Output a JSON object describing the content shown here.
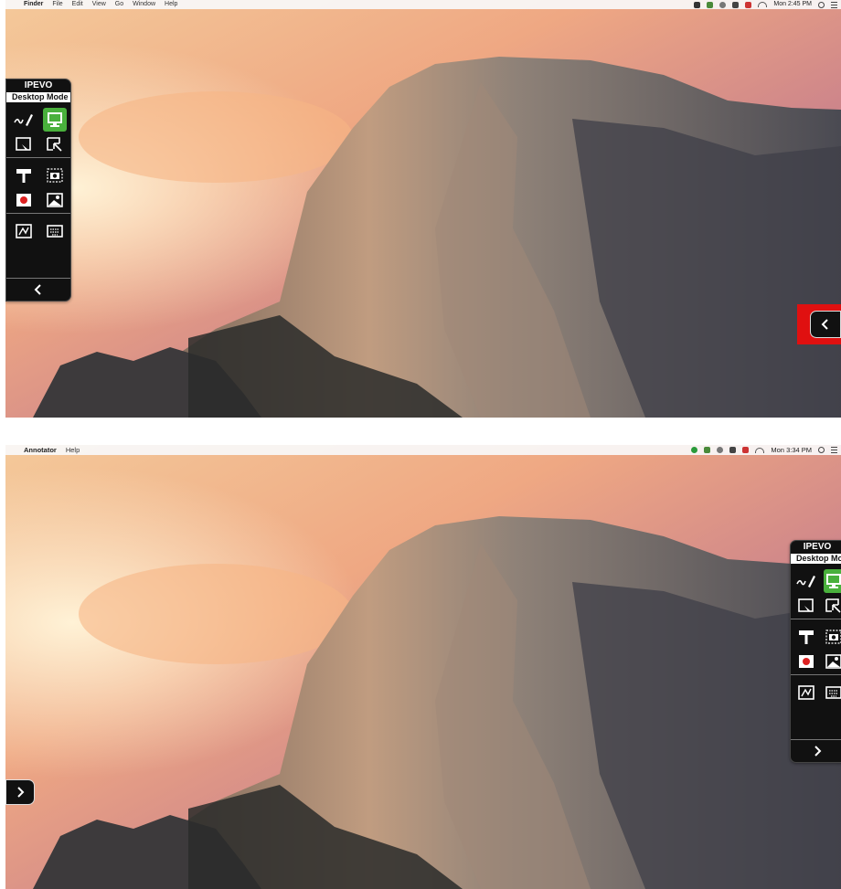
{
  "screenshot_top": {
    "menubar": {
      "app_name": "Finder",
      "menus": [
        "File",
        "Edit",
        "View",
        "Go",
        "Window",
        "Help"
      ],
      "clock": "Mon 2:45 PM"
    },
    "toolbar": {
      "brand": "IPEVO",
      "mode_label": "Desktop Mode",
      "collapse_glyph": "<"
    },
    "edge_tab_glyph": "<"
  },
  "screenshot_bottom": {
    "menubar": {
      "app_name": "Annotator",
      "menus": [
        "Help"
      ],
      "clock": "Mon 3:34 PM"
    },
    "toolbar": {
      "brand": "IPEVO",
      "mode_label": "Desktop Mode",
      "collapse_glyph": ">"
    },
    "edge_tab_glyph": ">"
  },
  "icons": {
    "annotation_mode": "pen-annotation-icon",
    "desktop_mode": "monitor-icon",
    "whiteboard": "whiteboard-icon",
    "screen_capture": "screen-capture-icon",
    "presenter": "projector-icon",
    "camera_snapshot": "camera-icon",
    "record": "record-icon",
    "gallery": "image-gallery-icon",
    "drawing_board": "drawing-board-icon",
    "keyboard": "keyboard-icon"
  },
  "colors": {
    "active_green": "#49b03c",
    "highlight_red": "#e01010",
    "toolbar_black": "#111111"
  }
}
